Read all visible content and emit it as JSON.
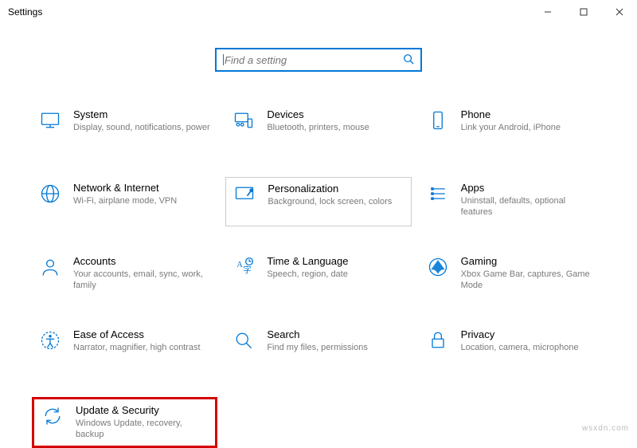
{
  "window": {
    "title": "Settings"
  },
  "search": {
    "placeholder": "Find a setting"
  },
  "tiles": {
    "system": {
      "title": "System",
      "desc": "Display, sound, notifications, power"
    },
    "devices": {
      "title": "Devices",
      "desc": "Bluetooth, printers, mouse"
    },
    "phone": {
      "title": "Phone",
      "desc": "Link your Android, iPhone"
    },
    "network": {
      "title": "Network & Internet",
      "desc": "Wi-Fi, airplane mode, VPN"
    },
    "personal": {
      "title": "Personalization",
      "desc": "Background, lock screen, colors"
    },
    "apps": {
      "title": "Apps",
      "desc": "Uninstall, defaults, optional features"
    },
    "accounts": {
      "title": "Accounts",
      "desc": "Your accounts, email, sync, work, family"
    },
    "time": {
      "title": "Time & Language",
      "desc": "Speech, region, date"
    },
    "gaming": {
      "title": "Gaming",
      "desc": "Xbox Game Bar, captures, Game Mode"
    },
    "ease": {
      "title": "Ease of Access",
      "desc": "Narrator, magnifier, high contrast"
    },
    "search_tile": {
      "title": "Search",
      "desc": "Find my files, permissions"
    },
    "privacy": {
      "title": "Privacy",
      "desc": "Location, camera, microphone"
    },
    "update": {
      "title": "Update & Security",
      "desc": "Windows Update, recovery, backup"
    }
  },
  "watermark": "wsxdn.com"
}
